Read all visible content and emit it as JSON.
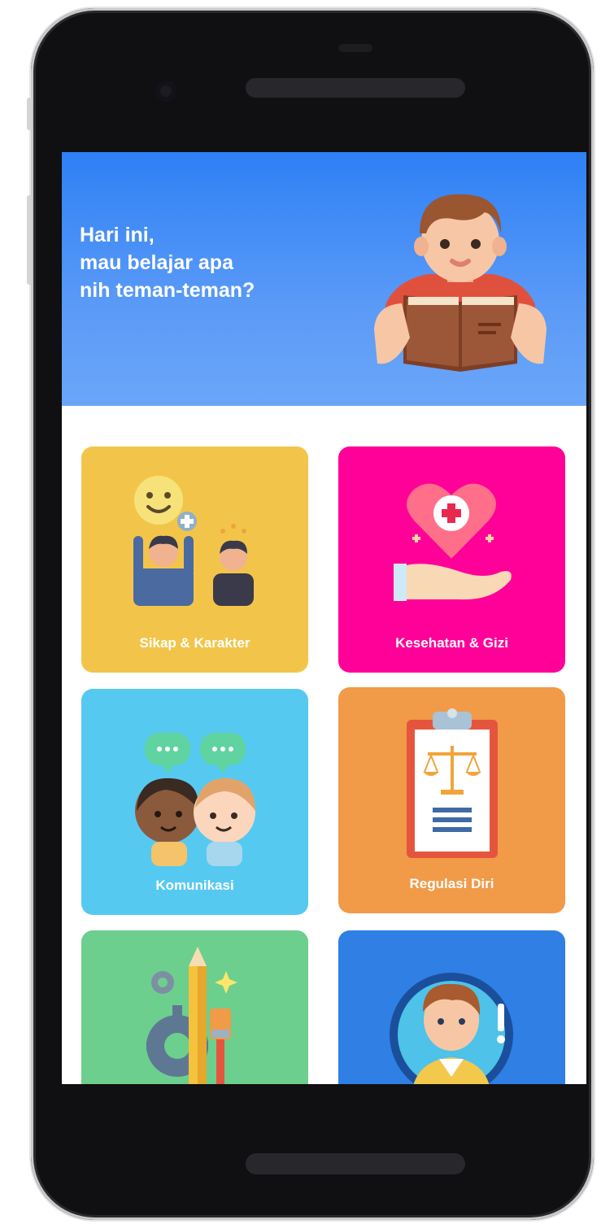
{
  "header": {
    "greeting_line1": "Hari ini,",
    "greeting_line2": "mau belajar apa",
    "greeting_line3": "nih teman-teman?"
  },
  "categories": [
    {
      "label": "Sikap & Karakter",
      "color": "#f2c54a",
      "icon": "people-smile-icon"
    },
    {
      "label": "Kesehatan & Gizi",
      "color": "#ff0099",
      "icon": "heart-health-icon"
    },
    {
      "label": "Komunikasi",
      "color": "#56c9f1",
      "icon": "chat-faces-icon"
    },
    {
      "label": "Regulasi Diri",
      "color": "#f19a48",
      "icon": "clipboard-scale-icon"
    },
    {
      "label": "",
      "color": "#6ccf8d",
      "icon": "creativity-tools-icon"
    },
    {
      "label": "",
      "color": "#2f7fe4",
      "icon": "boy-portrait-icon"
    }
  ],
  "colors": {
    "banner_top": "#2e80f6",
    "banner_bottom": "#6ba6f8",
    "phone_body": "#101012"
  }
}
